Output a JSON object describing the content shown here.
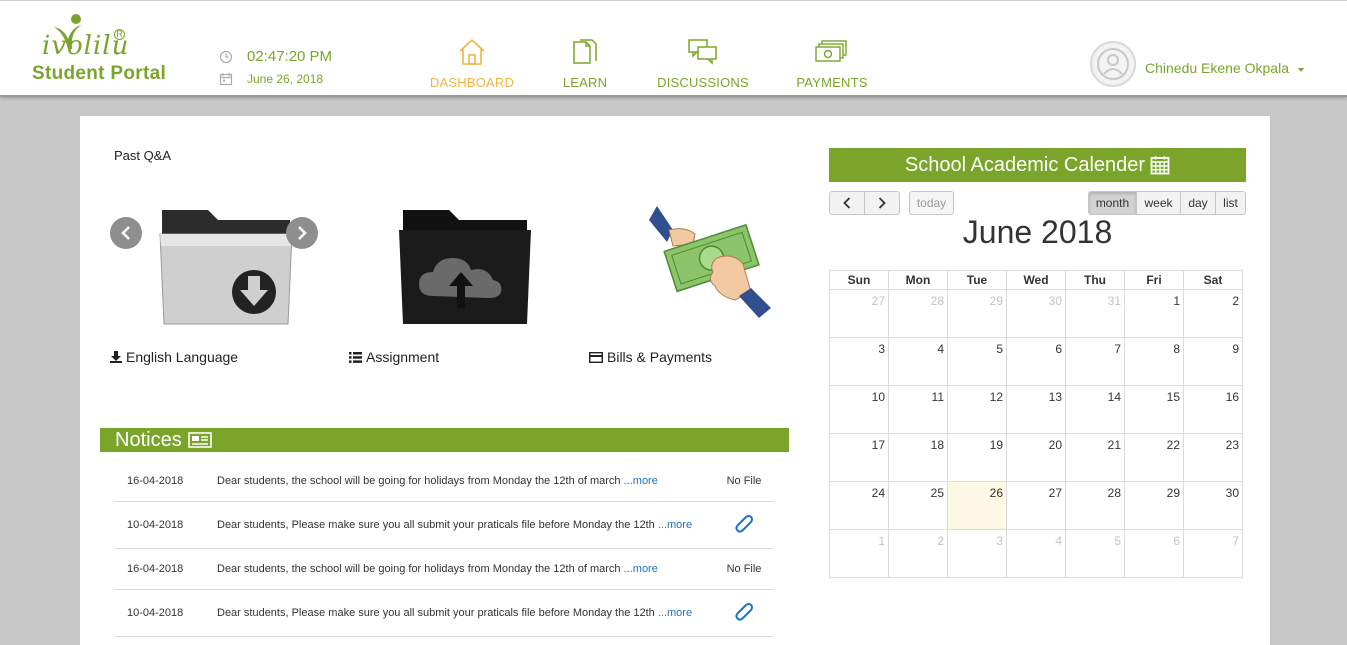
{
  "logo": {
    "word": "ivolilu",
    "registered": "R",
    "subtitle": "Student Portal"
  },
  "clock": {
    "time": "02:47:20 PM",
    "date": "June 26, 2018"
  },
  "nav": [
    {
      "label": "DASHBOARD",
      "icon": "home-icon",
      "active": true
    },
    {
      "label": "LEARN",
      "icon": "documents-icon",
      "active": false
    },
    {
      "label": "DISCUSSIONS",
      "icon": "chat-bubbles-icon",
      "active": false
    },
    {
      "label": "PAYMENTS",
      "icon": "money-icon",
      "active": false
    }
  ],
  "user": {
    "name": "Chinedu Ekene Okpala"
  },
  "past_qa": {
    "title": "Past Q&A",
    "tiles": [
      {
        "caption": "English Language",
        "icon": "download-icon",
        "image": "folder-download-image"
      },
      {
        "caption": "Assignment",
        "icon": "list-icon",
        "image": "folder-upload-image"
      },
      {
        "caption": "Bills & Payments",
        "icon": "credit-card-icon",
        "image": "cash-hand-image"
      }
    ]
  },
  "notices": {
    "title": "Notices",
    "more_label": "...more",
    "rows": [
      {
        "date": "16-04-2018",
        "text": "Dear students, the school will be going for holidays from Monday the 12th of march ",
        "file": "No File"
      },
      {
        "date": "10-04-2018",
        "text": "Dear students, Please make sure you all submit your praticals file before Monday the 12th ",
        "file": ""
      },
      {
        "date": "16-04-2018",
        "text": "Dear students, the school will be going for holidays from Monday the 12th of march ",
        "file": "No File"
      },
      {
        "date": "10-04-2018",
        "text": "Dear students, Please make sure you all submit your praticals file before Monday the 12th ",
        "file": ""
      }
    ]
  },
  "calendar": {
    "title": "School Academic Calender",
    "today_label": "today",
    "views": [
      "month",
      "week",
      "day",
      "list"
    ],
    "active_view": "month",
    "month_title": "June 2018",
    "weekdays": [
      "Sun",
      "Mon",
      "Tue",
      "Wed",
      "Thu",
      "Fri",
      "Sat"
    ],
    "weeks": [
      [
        {
          "d": "27",
          "o": true
        },
        {
          "d": "28",
          "o": true
        },
        {
          "d": "29",
          "o": true
        },
        {
          "d": "30",
          "o": true
        },
        {
          "d": "31",
          "o": true
        },
        {
          "d": "1"
        },
        {
          "d": "2"
        }
      ],
      [
        {
          "d": "3"
        },
        {
          "d": "4"
        },
        {
          "d": "5"
        },
        {
          "d": "6"
        },
        {
          "d": "7"
        },
        {
          "d": "8"
        },
        {
          "d": "9"
        }
      ],
      [
        {
          "d": "10"
        },
        {
          "d": "11"
        },
        {
          "d": "12"
        },
        {
          "d": "13"
        },
        {
          "d": "14"
        },
        {
          "d": "15"
        },
        {
          "d": "16"
        }
      ],
      [
        {
          "d": "17"
        },
        {
          "d": "18"
        },
        {
          "d": "19"
        },
        {
          "d": "20"
        },
        {
          "d": "21"
        },
        {
          "d": "22"
        },
        {
          "d": "23"
        }
      ],
      [
        {
          "d": "24"
        },
        {
          "d": "25"
        },
        {
          "d": "26",
          "today": true
        },
        {
          "d": "27"
        },
        {
          "d": "28"
        },
        {
          "d": "29"
        },
        {
          "d": "30"
        }
      ],
      [
        {
          "d": "1",
          "o": true
        },
        {
          "d": "2",
          "o": true
        },
        {
          "d": "3",
          "o": true
        },
        {
          "d": "4",
          "o": true
        },
        {
          "d": "5",
          "o": true
        },
        {
          "d": "6",
          "o": true
        },
        {
          "d": "7",
          "o": true
        }
      ]
    ]
  },
  "colors": {
    "brand_green": "#7aa52a",
    "active_nav": "#f0b541",
    "link_blue": "#1a73c8",
    "today_bg": "#fcf8e3"
  }
}
